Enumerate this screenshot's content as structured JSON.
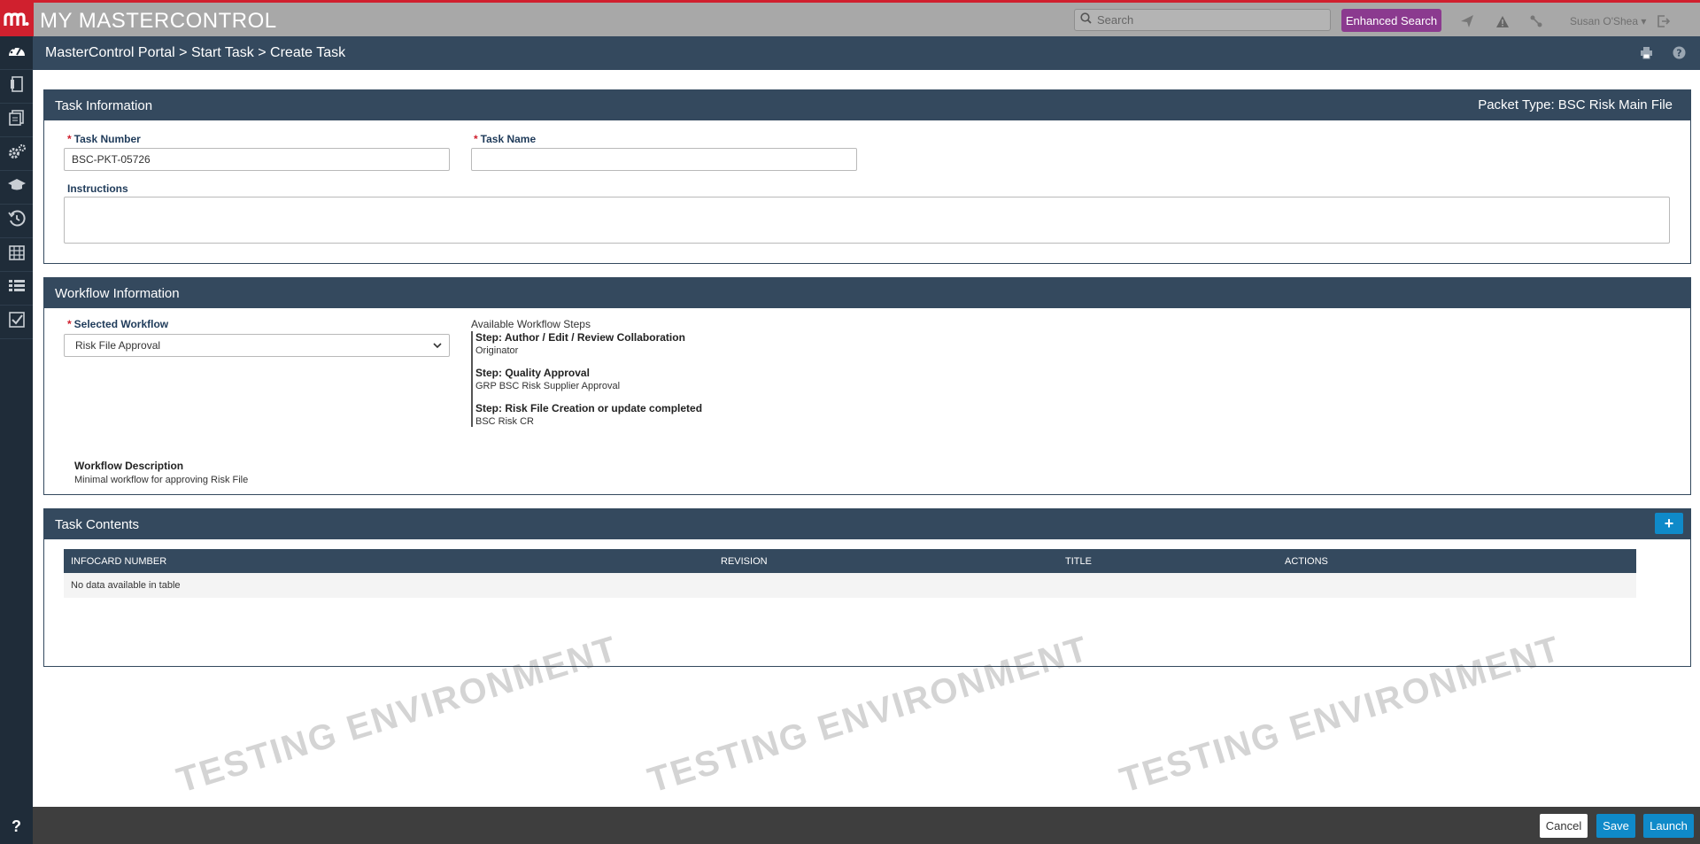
{
  "header": {
    "brand": "MY MASTERCONTROL",
    "search_placeholder": "Search",
    "enhanced_search_label": "Enhanced Search",
    "user_name": "Susan O'Shea"
  },
  "breadcrumb": "MasterControl Portal > Start Task > Create Task",
  "watermark": "TESTING ENVIRONMENT",
  "task_info": {
    "title": "Task Information",
    "packet_type": "Packet Type: BSC Risk Main File",
    "task_number_label": "Task Number",
    "task_number_value": "BSC-PKT-05726",
    "task_name_label": "Task Name",
    "task_name_value": "",
    "instructions_label": "Instructions",
    "instructions_value": ""
  },
  "workflow": {
    "title": "Workflow Information",
    "selected_label": "Selected Workflow",
    "selected_value": "Risk File Approval",
    "steps_title": "Available Workflow Steps",
    "steps": [
      {
        "name": "Step: Author / Edit / Review Collaboration",
        "group": "Originator"
      },
      {
        "name": "Step: Quality Approval",
        "group": "GRP BSC Risk Supplier Approval"
      },
      {
        "name": "Step: Risk File Creation or update completed",
        "group": "BSC Risk CR"
      }
    ],
    "description_label": "Workflow Description",
    "description_value": "Minimal workflow for approving Risk File"
  },
  "task_contents": {
    "title": "Task Contents",
    "add_label": "+",
    "columns": [
      "INFOCARD NUMBER",
      "REVISION",
      "TITLE",
      "ACTIONS"
    ],
    "empty_message": "No data available in table"
  },
  "footer": {
    "cancel_label": "Cancel",
    "save_label": "Save",
    "launch_label": "Launch"
  },
  "help_label": "?"
}
